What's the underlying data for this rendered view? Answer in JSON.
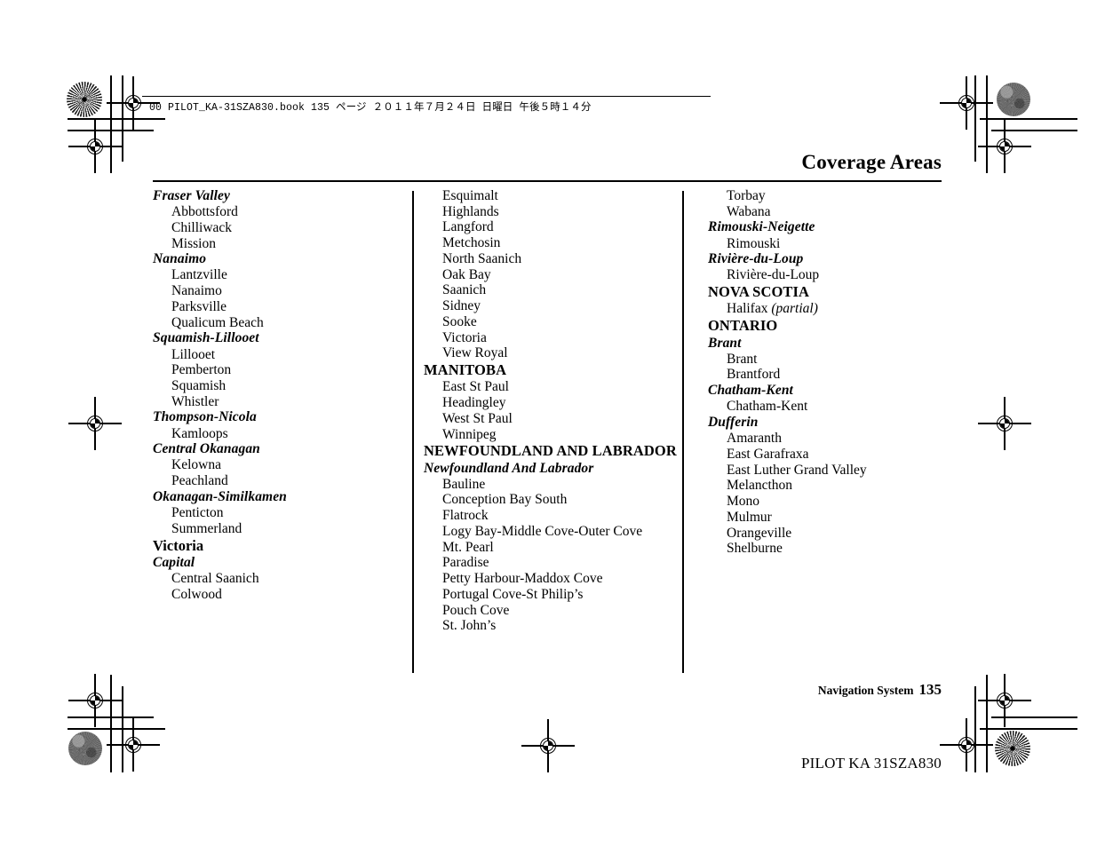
{
  "slug": {
    "text": "00 PILOT_KA-31SZA830.book   135 ページ   ２０１１年７月２４日   日曜日   午後５時１４分"
  },
  "header": {
    "title": "Coverage Areas"
  },
  "footer": {
    "label": "Navigation System",
    "page_number": "135",
    "imprint": "PILOT KA  31SZA830"
  },
  "columns": [
    {
      "id": "column-1",
      "blocks": [
        {
          "type": "region",
          "heading": "Fraser Valley",
          "entries": [
            "Abbottsford",
            "Chilliwack",
            "Mission"
          ]
        },
        {
          "type": "region",
          "heading": "Nanaimo",
          "entries": [
            "Lantzville",
            "Nanaimo",
            "Parksville",
            "Qualicum Beach"
          ]
        },
        {
          "type": "region",
          "heading": "Squamish-Lillooet",
          "entries": [
            "Lillooet",
            "Pemberton",
            "Squamish",
            "Whistler"
          ]
        },
        {
          "type": "region",
          "heading": "Thompson-Nicola",
          "entries": [
            "Kamloops"
          ]
        },
        {
          "type": "region",
          "heading": "Central Okanagan",
          "entries": [
            "Kelowna",
            "Peachland"
          ]
        },
        {
          "type": "region",
          "heading": "Okanagan-Similkamen",
          "entries": [
            "Penticton",
            "Summerland"
          ]
        },
        {
          "type": "city",
          "heading": "Victoria",
          "entries": []
        },
        {
          "type": "region",
          "heading": "Capital",
          "entries": [
            "Central Saanich",
            "Colwood"
          ]
        }
      ]
    },
    {
      "id": "column-2",
      "blocks": [
        {
          "type": "continued",
          "heading": "",
          "entries": [
            "Esquimalt",
            "Highlands",
            "Langford",
            "Metchosin",
            "North Saanich",
            "Oak Bay",
            "Saanich",
            "Sidney",
            "Sooke",
            "Victoria",
            "View Royal"
          ]
        },
        {
          "type": "province",
          "heading": "MANITOBA",
          "entries": [
            "East St Paul",
            "Headingley",
            "West St Paul",
            "Winnipeg"
          ]
        },
        {
          "type": "province",
          "heading": "NEWFOUNDLAND AND LABRADOR",
          "entries": []
        },
        {
          "type": "region",
          "heading": "Newfoundland And Labrador",
          "entries": [
            "Bauline",
            "Conception Bay South",
            "Flatrock",
            "Logy Bay-Middle Cove-Outer Cove",
            "Mt. Pearl",
            "Paradise",
            "Petty Harbour-Maddox Cove",
            "Portugal Cove-St Philip’s",
            "Pouch Cove",
            "St. John’s"
          ]
        }
      ]
    },
    {
      "id": "column-3",
      "blocks": [
        {
          "type": "continued",
          "heading": "",
          "entries": [
            "Torbay",
            "Wabana"
          ]
        },
        {
          "type": "region",
          "heading": "Rimouski-Neigette",
          "entries": [
            "Rimouski"
          ]
        },
        {
          "type": "region",
          "heading": "Rivière-du-Loup",
          "entries": [
            "Rivière-du-Loup"
          ]
        },
        {
          "type": "province",
          "heading": "NOVA SCOTIA",
          "entries": [
            "Halifax (partial)"
          ]
        },
        {
          "type": "province",
          "heading": "ONTARIO",
          "entries": []
        },
        {
          "type": "region",
          "heading": "Brant",
          "entries": [
            "Brant",
            "Brantford"
          ]
        },
        {
          "type": "region",
          "heading": "Chatham-Kent",
          "entries": [
            "Chatham-Kent"
          ]
        },
        {
          "type": "region",
          "heading": "Dufferin",
          "entries": [
            "Amaranth",
            "East Garafraxa",
            "East Luther Grand Valley",
            "Melancthon",
            "Mono",
            "Mulmur",
            "Orangeville",
            "Shelburne"
          ]
        }
      ]
    }
  ]
}
